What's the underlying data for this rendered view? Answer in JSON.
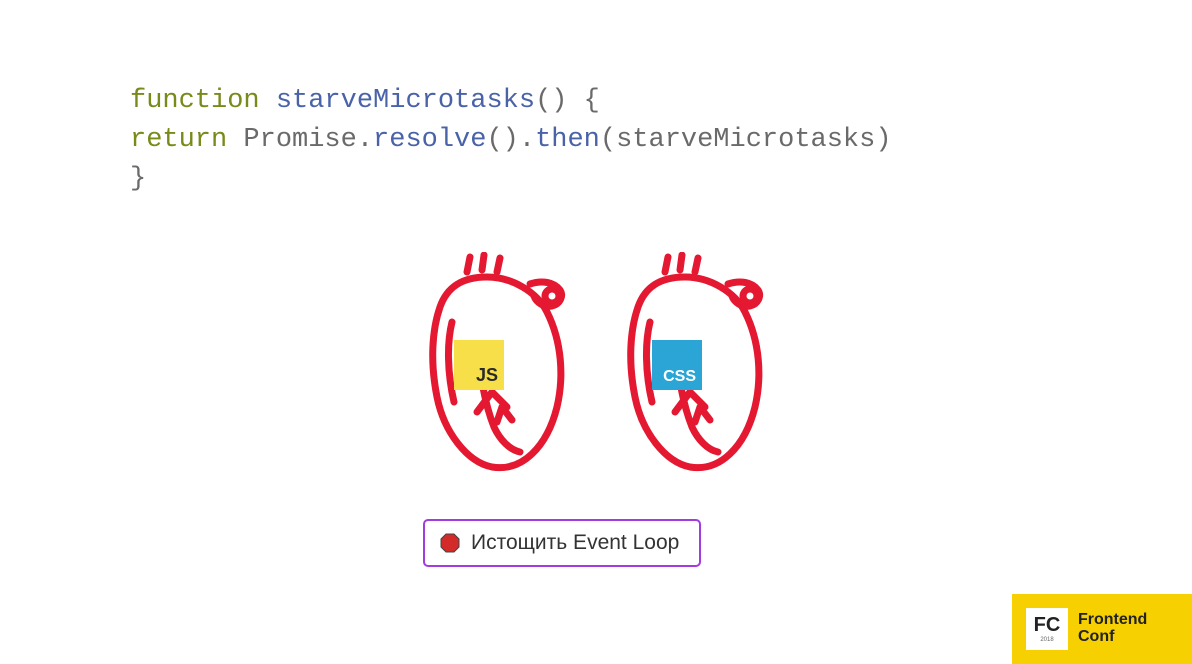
{
  "code": {
    "line1": {
      "kw": "function",
      "fn": "starveMicrotasks",
      "parens": "()",
      "brace": " {"
    },
    "line2": {
      "indent": "  ",
      "kw": "return",
      "space": " ",
      "obj": "Promise",
      "dot1": ".",
      "m1": "resolve",
      "p1": "()",
      "dot2": ".",
      "m2": "then",
      "open": "(",
      "arg": "starveMicrotasks",
      "close": ")"
    },
    "line3": {
      "brace": "}"
    }
  },
  "badges": {
    "js": "JS",
    "css": "CSS"
  },
  "button": {
    "label": "Истощить Event Loop"
  },
  "footer": {
    "fc": "FC",
    "year": "2018",
    "line1": "Frontend",
    "line2": "Conf"
  }
}
